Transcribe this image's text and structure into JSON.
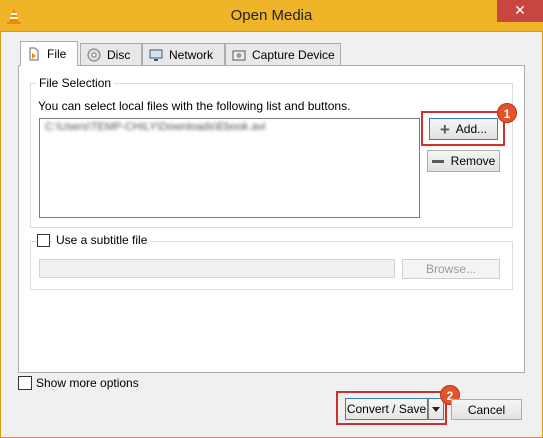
{
  "window": {
    "title": "Open Media",
    "close_glyph": "✕",
    "app_icon": "vlc-cone-icon"
  },
  "tabs": [
    {
      "label": "File",
      "icon": "file-icon",
      "active": true
    },
    {
      "label": "Disc",
      "icon": "disc-icon",
      "active": false
    },
    {
      "label": "Network",
      "icon": "network-icon",
      "active": false
    },
    {
      "label": "Capture Device",
      "icon": "capture-device-icon",
      "active": false
    }
  ],
  "file_selection": {
    "label": "File Selection",
    "hint": "You can select local files with the following list and buttons.",
    "files": [
      "C:\\Users\\TEMP-CHILY\\Downloads\\Ebook.avi"
    ],
    "add_label": "Add...",
    "remove_label": "Remove"
  },
  "subtitle": {
    "checkbox_label": "Use a subtitle file",
    "checked": false,
    "browse_label": "Browse..."
  },
  "footer": {
    "show_more_label": "Show more options",
    "show_more_checked": false,
    "convert_label": "Convert / Save",
    "cancel_label": "Cancel"
  },
  "annotations": {
    "marker_1": "1",
    "marker_2": "2",
    "color": "#d03030"
  }
}
